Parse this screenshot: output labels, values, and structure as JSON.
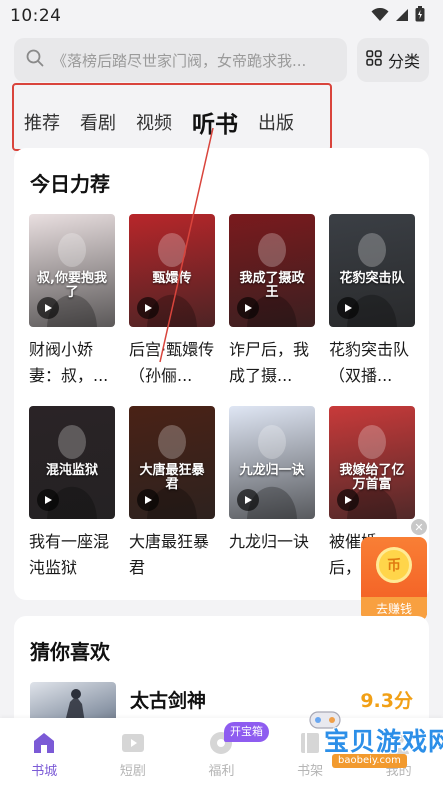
{
  "status_bar": {
    "time": "10:24",
    "icons": [
      "wifi-icon",
      "signal-icon",
      "battery-icon"
    ]
  },
  "search": {
    "placeholder": "《落榜后踏尽世家门阀，女帝跪求我...",
    "category_label": "分类"
  },
  "tabs": [
    {
      "label": "推荐",
      "active": false
    },
    {
      "label": "看剧",
      "active": false
    },
    {
      "label": "视频",
      "active": false
    },
    {
      "label": "听书",
      "active": true
    },
    {
      "label": "出版",
      "active": false
    }
  ],
  "today_picks": {
    "title": "今日力荐",
    "books": [
      {
        "name": "财阀小娇妻：叔，...",
        "cover_text": "叔,你要抱我了",
        "cover_color": "#e9dfe0"
      },
      {
        "name": "后宫·甄嬛传（孙俪...",
        "cover_text": "甄嬛传",
        "cover_color": "#b8262a"
      },
      {
        "name": "诈尸后，我成了摄...",
        "cover_text": "我成了摄政王",
        "cover_color": "#7a1a1d"
      },
      {
        "name": "花豹突击队（双播...",
        "cover_text": "花豹突击队",
        "cover_color": "#3b3f45"
      },
      {
        "name": "我有一座混沌监狱",
        "cover_text": "混沌监狱",
        "cover_color": "#2a2326"
      },
      {
        "name": "大唐最狂暴君",
        "cover_text": "大唐最狂暴君",
        "cover_color": "#4a2216"
      },
      {
        "name": "九龙归一诀",
        "cover_text": "九龙归一诀",
        "cover_color": "#dfe6f4"
      },
      {
        "name": "被催婚后，...",
        "cover_text": "我嫁给了亿万首富",
        "cover_color": "#c83a3a"
      }
    ]
  },
  "earn_widget": {
    "label": "去赚钱",
    "coin_symbol": "币"
  },
  "guess_you_like": {
    "title": "猜你喜欢",
    "book_title": "太古剑神",
    "score": "9.3分"
  },
  "bottom_nav": {
    "items": [
      {
        "label": "书城",
        "icon": "bookstore-icon",
        "active": true
      },
      {
        "label": "短剧",
        "icon": "video-icon",
        "active": false
      },
      {
        "label": "福利",
        "icon": "welfare-icon",
        "active": false
      },
      {
        "label": "书架",
        "icon": "bookshelf-icon",
        "active": false
      },
      {
        "label": "我的",
        "icon": "profile-icon",
        "active": false
      }
    ],
    "badge": "开宝箱"
  },
  "watermark": {
    "text": "宝贝游戏网",
    "url": "baobeiy.com"
  },
  "colors": {
    "accent": "#7b5ad6",
    "highlight_box": "#d9443c",
    "score": "#f1a016",
    "earn": "#f25a22"
  }
}
